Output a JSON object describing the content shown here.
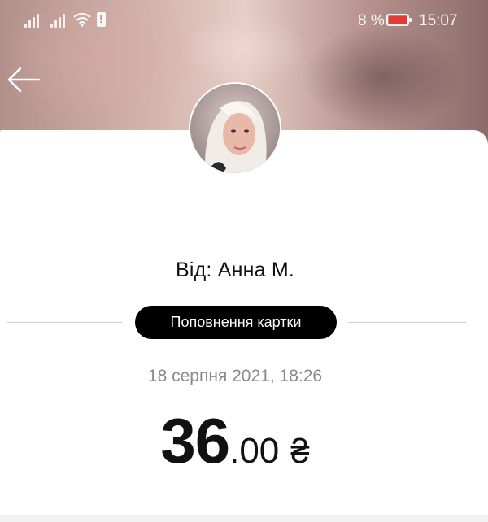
{
  "status_bar": {
    "battery_percent": "8 %",
    "time": "15:07",
    "icons": [
      "signal-icon",
      "signal-icon",
      "wifi-icon",
      "sim-alert-icon",
      "battery-low-icon"
    ]
  },
  "header": {
    "back_icon": "arrow-left-icon"
  },
  "transfer": {
    "sender_label": "Від: Анна М.",
    "type_label": "Поповнення картки",
    "datetime": "18 серпня 2021, 18:26",
    "amount_integer": "36",
    "amount_decimal": ".00",
    "currency_symbol": "₴"
  },
  "colors": {
    "pill_background": "#000000",
    "pill_text": "#ffffff",
    "date_text": "#8a8a8a",
    "battery_level": "#e53935"
  }
}
